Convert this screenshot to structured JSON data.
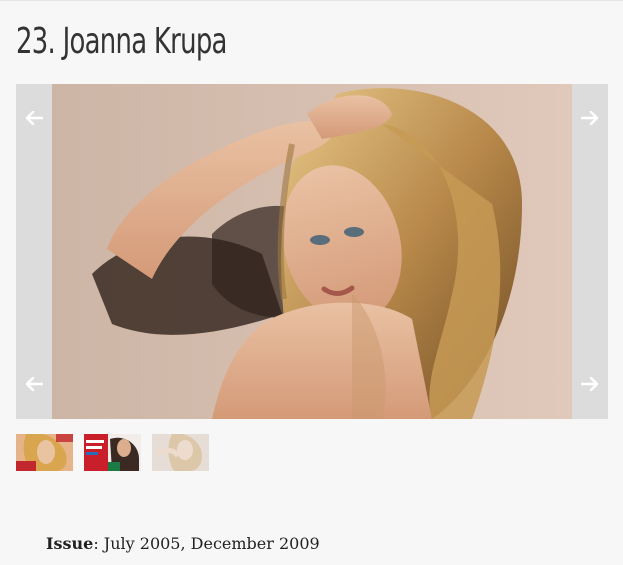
{
  "article": {
    "title": "23. Joanna Krupa",
    "issue_label": "Issue",
    "issue_separator": ": ",
    "issue_value": "July 2005, December 2009"
  },
  "gallery": {
    "prev_icon": "arrow-left-icon",
    "next_icon": "arrow-right-icon",
    "thumbnail_count": 3,
    "active_thumbnail": 1
  },
  "colors": {
    "background": "#f7f7f8",
    "gallery_frame": "#dcdcdc",
    "title_text": "#333333",
    "arrow": "#ffffff"
  }
}
